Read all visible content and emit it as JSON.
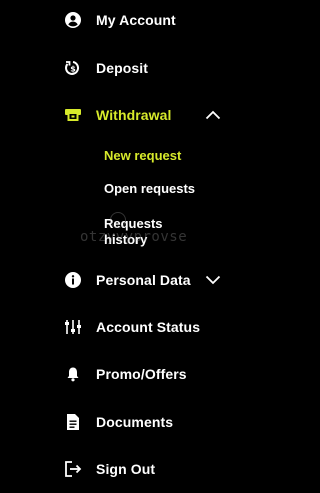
{
  "colors": {
    "background": "#000000",
    "text": "#ffffff",
    "accent": "#d7ea2b"
  },
  "menu": {
    "items": [
      {
        "label": "My Account",
        "icon": "account-circle-icon"
      },
      {
        "label": "Deposit",
        "icon": "deposit-icon"
      },
      {
        "label": "Withdrawal",
        "icon": "withdrawal-icon",
        "expanded": true,
        "active": true,
        "submenu": [
          {
            "label": "New request",
            "active": true
          },
          {
            "label": "Open requests"
          },
          {
            "label": "Requests history"
          }
        ]
      },
      {
        "label": "Personal Data",
        "icon": "info-icon",
        "expanded": false
      },
      {
        "label": "Account Status",
        "icon": "sliders-icon"
      },
      {
        "label": "Promo/Offers",
        "icon": "bell-icon"
      },
      {
        "label": "Documents",
        "icon": "document-icon"
      },
      {
        "label": "Sign Out",
        "icon": "sign-out-icon"
      }
    ]
  },
  "watermark": {
    "text": "otzyvyprovse"
  }
}
